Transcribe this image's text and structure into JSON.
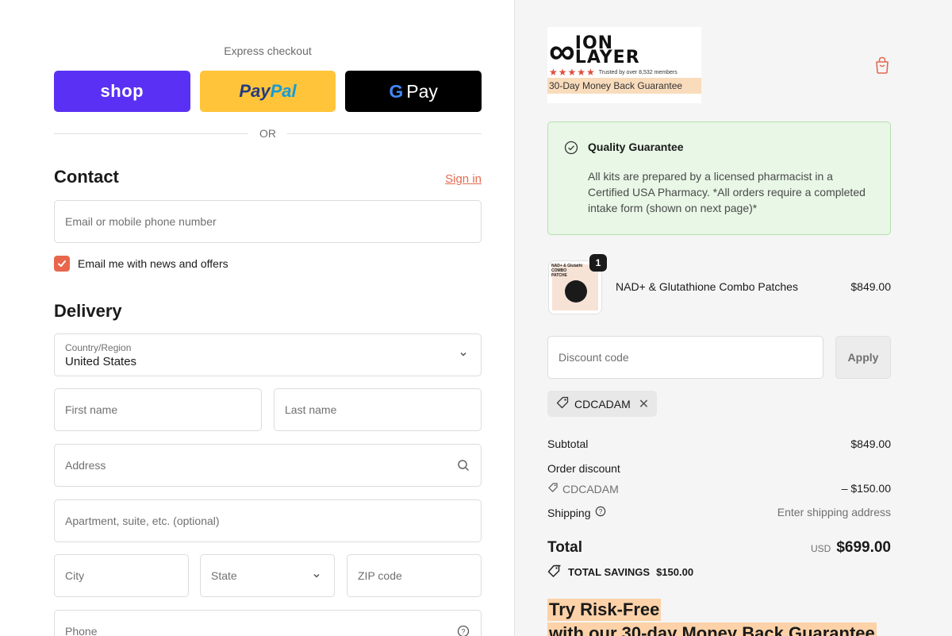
{
  "express": {
    "label": "Express checkout",
    "shop_label": "shop",
    "paypal_part1": "Pay",
    "paypal_part2": "Pal",
    "gpay_g": "G",
    "gpay_label": "Pay",
    "or_label": "OR"
  },
  "contact": {
    "title": "Contact",
    "signin_label": "Sign in",
    "email_placeholder": "Email or mobile phone number",
    "newsletter_label": "Email me with news and offers",
    "newsletter_checked": true
  },
  "delivery": {
    "title": "Delivery",
    "country_label": "Country/Region",
    "country_value": "United States",
    "first_name_placeholder": "First name",
    "last_name_placeholder": "Last name",
    "address_placeholder": "Address",
    "apartment_placeholder": "Apartment, suite, etc. (optional)",
    "city_placeholder": "City",
    "state_placeholder": "State",
    "zip_placeholder": "ZIP code",
    "phone_placeholder": "Phone"
  },
  "brand": {
    "name_line1": "ION",
    "name_line2": "LAYER",
    "symbol": "∞",
    "stars": "★★★★★",
    "trusted": "Trusted by over 8,532 members",
    "guarantee": "30-Day Money Back Guarantee"
  },
  "quality": {
    "title": "Quality Guarantee",
    "text": "All kits are prepared by a licensed pharmacist in a Certified USA Pharmacy. *All orders require a completed intake form (shown on next page)*"
  },
  "cart": {
    "items": [
      {
        "name": "NAD+ & Glutathione Combo Patches",
        "price": "$849.00",
        "quantity": "1",
        "thumb_label": "NAD+ & Glutathi COMBO PATCHE"
      }
    ]
  },
  "discount": {
    "placeholder": "Discount code",
    "apply_label": "Apply",
    "applied_code": "CDCADAM"
  },
  "summary": {
    "subtotal_label": "Subtotal",
    "subtotal_value": "$849.00",
    "order_discount_label": "Order discount",
    "discount_code": "CDCADAM",
    "discount_value": "– $150.00",
    "shipping_label": "Shipping",
    "shipping_value": "Enter shipping address",
    "total_label": "Total",
    "currency": "USD",
    "total_value": "$699.00",
    "savings_label": "TOTAL SAVINGS",
    "savings_value": "$150.00"
  },
  "promo": {
    "line1": "Try Risk-Free",
    "line2": "with our 30-day Money Back Guarantee"
  },
  "colors": {
    "shop": "#5a31f4",
    "paypal": "#ffc439",
    "gpay": "#000000",
    "accent": "#e36a4f",
    "quality_bg": "#e8f7e6",
    "highlight": "#fdd2a8"
  }
}
